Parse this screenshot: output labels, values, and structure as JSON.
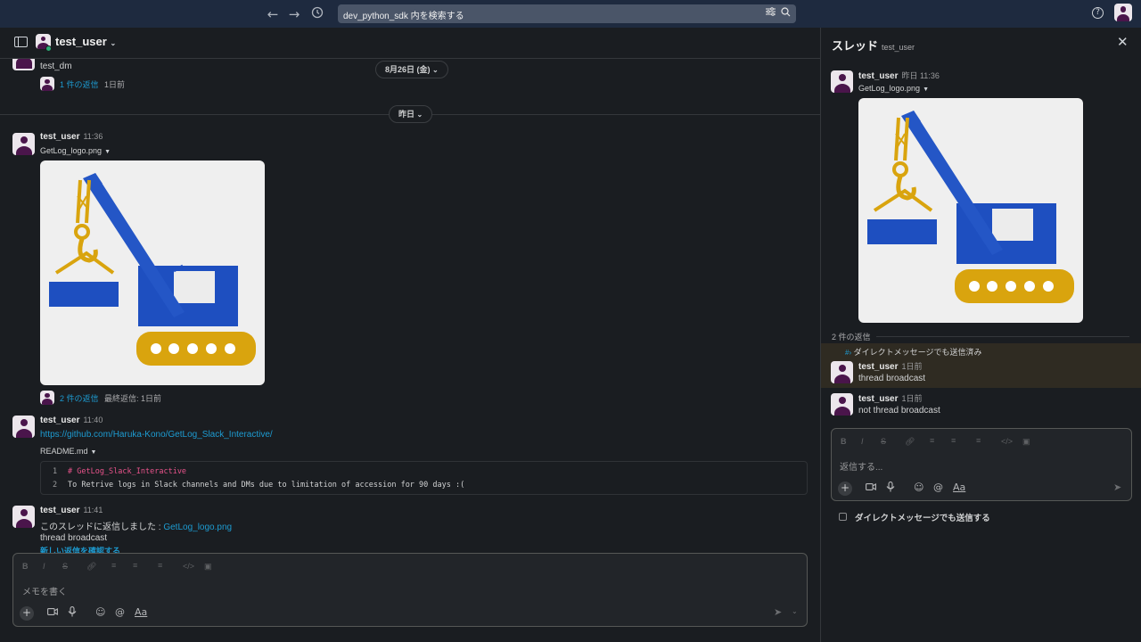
{
  "topbar": {
    "back_icon": "arrow-left-icon",
    "forward_icon": "arrow-right-icon",
    "history_icon": "clock-icon",
    "search_placeholder": "dev_python_sdk 内を検索する",
    "help_label": "?"
  },
  "channel_header": {
    "title": "test_user"
  },
  "main": {
    "early_msg": {
      "text": "test_dm",
      "reply_link": "1 件の返信",
      "reply_time": "1日前"
    },
    "date_pills": [
      "8月26日 (金)",
      "昨日"
    ],
    "messages": [
      {
        "author": "test_user",
        "time": "11:36",
        "file": "GetLog_logo.png",
        "reply_link": "2 件の返信",
        "reply_last": "最終返信: 1日前"
      },
      {
        "author": "test_user",
        "time": "11:40",
        "link": "https://github.com/Haruka-Kono/GetLog_Slack_Interactive/",
        "file": "README.md",
        "code": [
          {
            "n": "1",
            "text": "# GetLog_Slack_Interactive"
          },
          {
            "n": "2",
            "text": "To Retrive logs in Slack channels and DMs due to limitation of accession for 90 days :("
          }
        ]
      },
      {
        "author": "test_user",
        "time": "11:41",
        "prefix": "このスレッドに返信しました : ",
        "ref_link": "GetLog_logo.png",
        "text": "thread broadcast",
        "new_replies": "新しい返信を確認する"
      }
    ],
    "composer": {
      "placeholder": "メモを書く",
      "aa_label": "Aa",
      "format_icons": [
        "B",
        "I",
        "S"
      ]
    }
  },
  "thread": {
    "title": "スレッド",
    "subtitle": "test_user",
    "parent": {
      "author": "test_user",
      "time": "昨日 11:36",
      "file": "GetLog_logo.png"
    },
    "reply_count": "2 件の返信",
    "broadcast_label": "ダイレクトメッセージでも送信済み",
    "replies": [
      {
        "author": "test_user",
        "time": "1日前",
        "text": "thread broadcast"
      },
      {
        "author": "test_user",
        "time": "1日前",
        "text": "not thread broadcast"
      }
    ],
    "composer": {
      "placeholder": "返信する...",
      "aa_label": "Aa",
      "format_icons": [
        "B",
        "I",
        "S"
      ]
    },
    "also_send_label": "ダイレクトメッセージでも送信する"
  },
  "colors": {
    "accent_link": "#1d9bd1",
    "topbar": "#1e2a3f",
    "background": "#1a1d21",
    "avatar": "#4a154b",
    "online": "#2bac76"
  }
}
